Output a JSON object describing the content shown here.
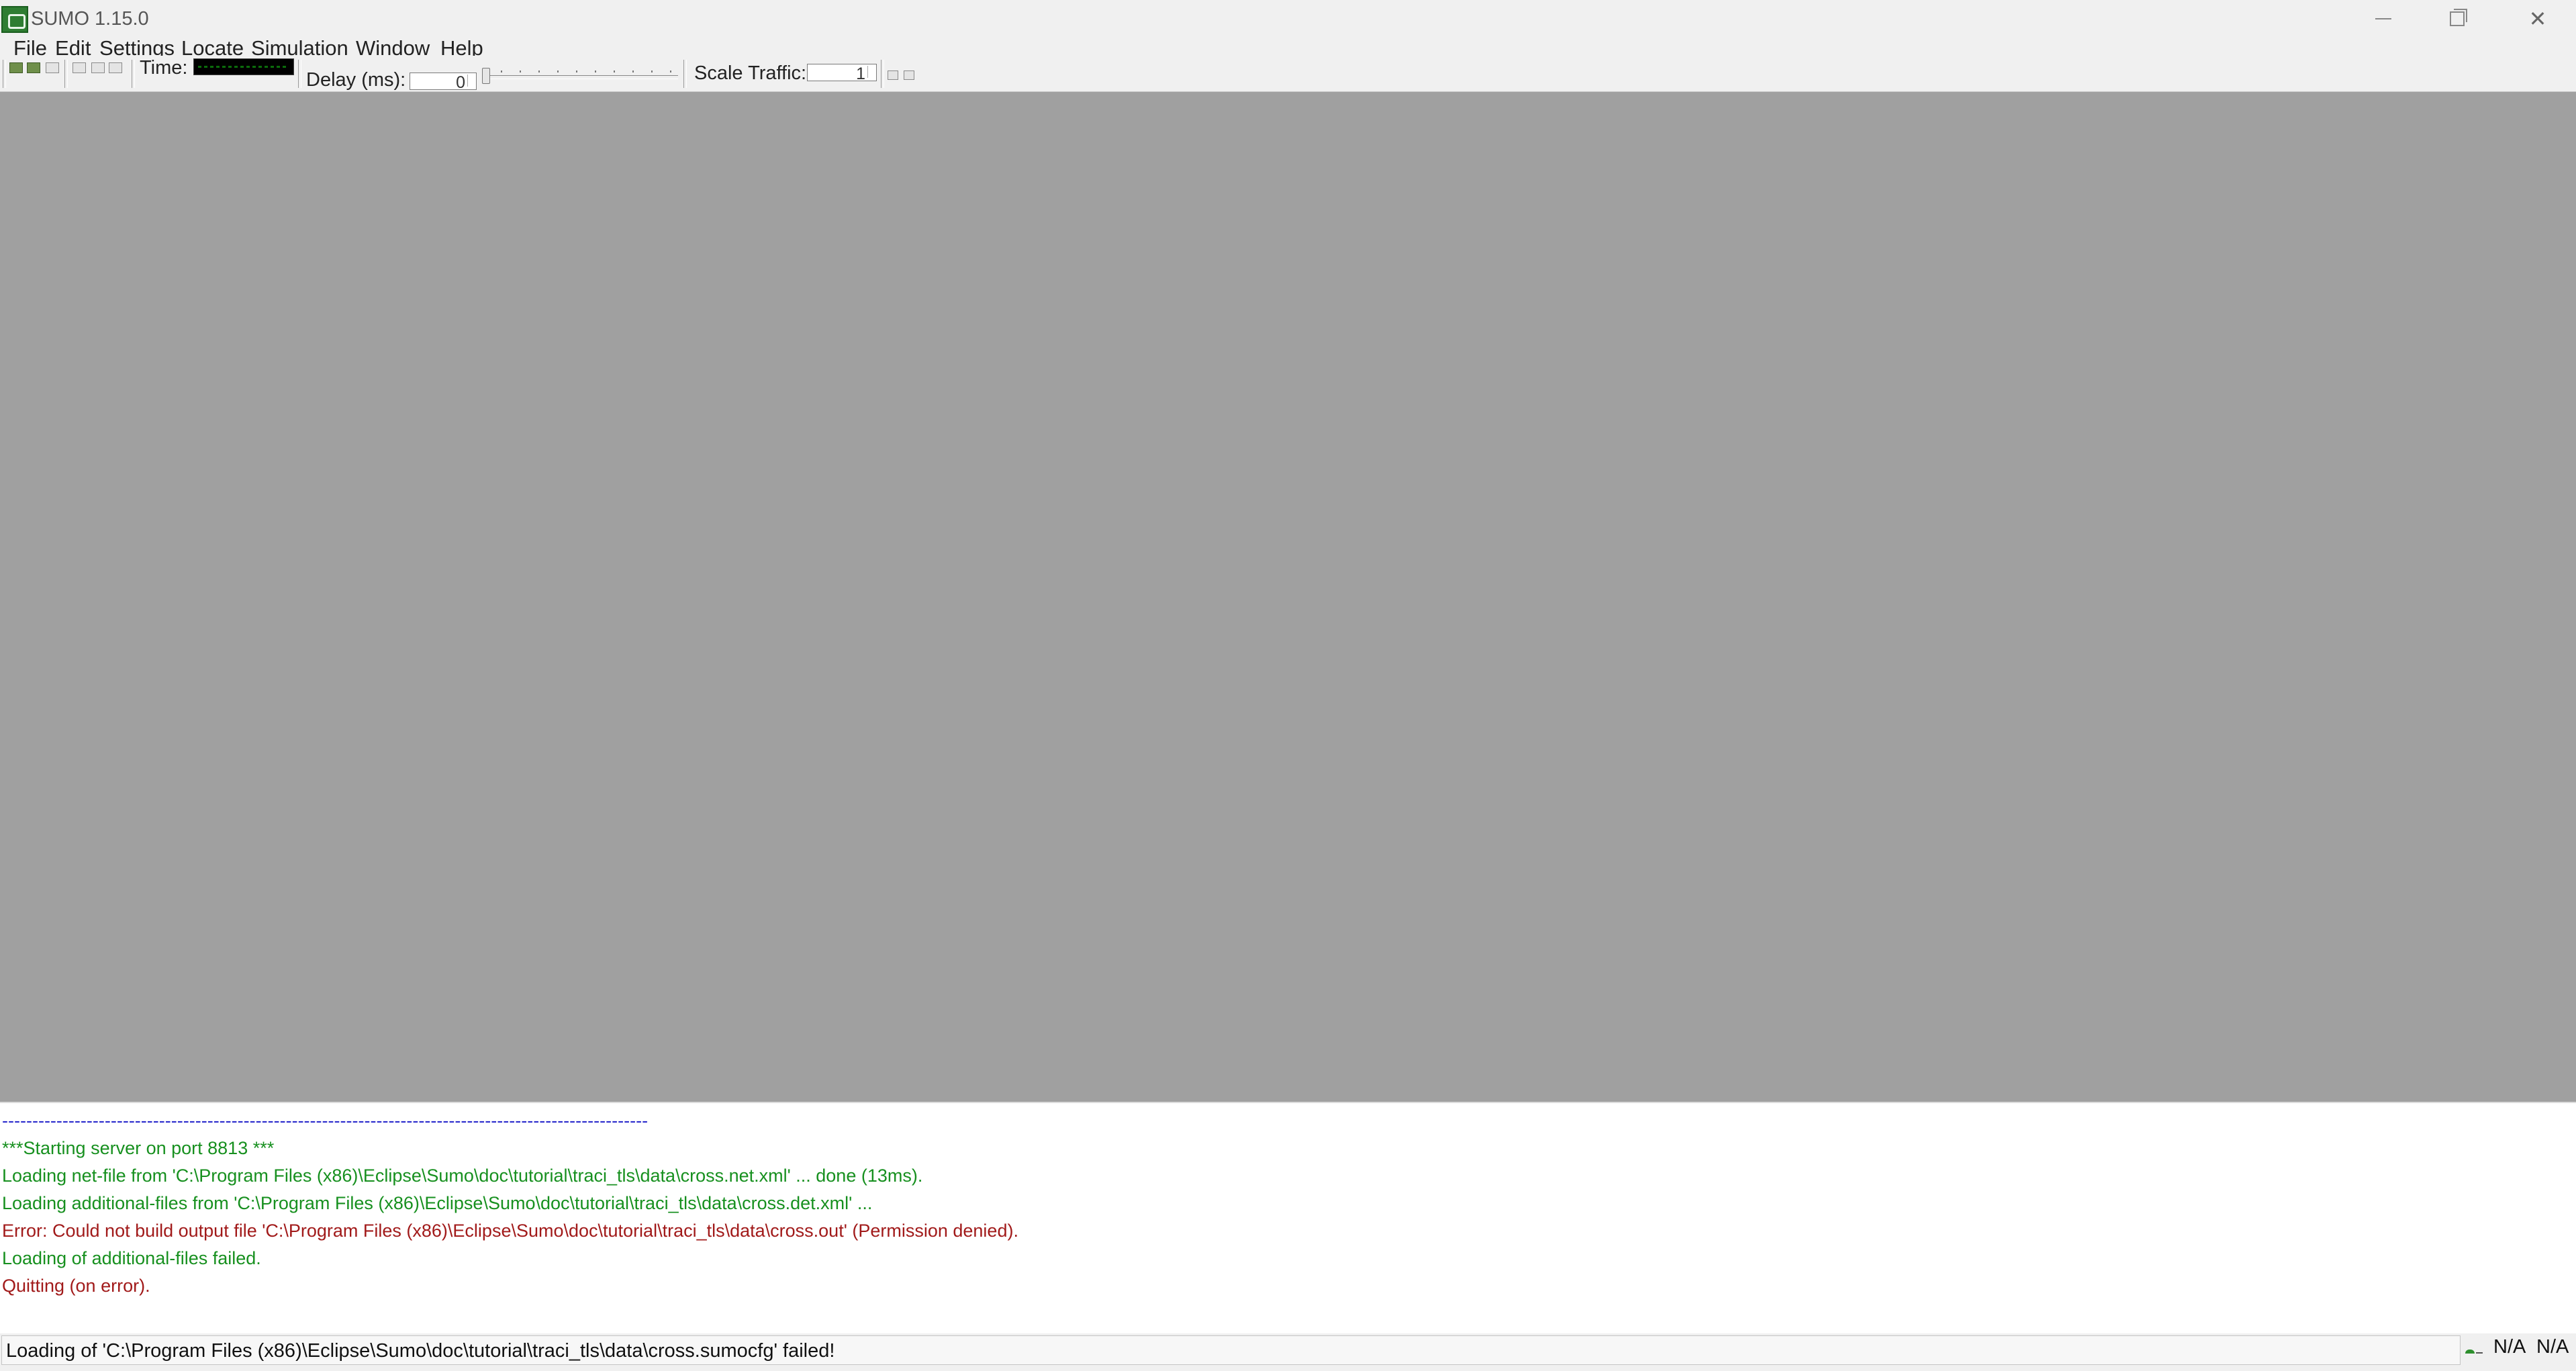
{
  "window": {
    "title": "SUMO 1.15.0"
  },
  "menu": {
    "items": [
      "File",
      "Edit",
      "Settings",
      "Locate",
      "Simulation",
      "Window",
      "Help"
    ]
  },
  "toolbar": {
    "time_label": "Time:",
    "delay_label": "Delay (ms):",
    "delay_value": "0",
    "scale_label": "Scale Traffic:",
    "scale_value": "1"
  },
  "log": {
    "lines": [
      {
        "text": "-----------------------------------------------------------------------------------------------------------",
        "status": "separator"
      },
      {
        "text": "***Starting server on port 8813 ***",
        "status": "ok"
      },
      {
        "text": "Loading net-file from 'C:\\Program Files (x86)\\Eclipse\\Sumo\\doc\\tutorial\\traci_tls\\data\\cross.net.xml' ... done (13ms).",
        "status": "ok"
      },
      {
        "text": "Loading additional-files from 'C:\\Program Files (x86)\\Eclipse\\Sumo\\doc\\tutorial\\traci_tls\\data\\cross.det.xml' ...",
        "status": "ok"
      },
      {
        "text": "Error: Could not build output file 'C:\\Program Files (x86)\\Eclipse\\Sumo\\doc\\tutorial\\traci_tls\\data\\cross.out' (Permission denied).",
        "status": "error"
      },
      {
        "text": "Loading of additional-files failed.",
        "status": "ok"
      },
      {
        "text": "Quitting (on error).",
        "status": "error"
      }
    ]
  },
  "status": {
    "message": "Loading of 'C:\\Program Files (x86)\\Eclipse\\Sumo\\doc\\tutorial\\traci_tls\\data\\cross.sumocfg' failed!",
    "coord_x": "N/A",
    "coord_y": "N/A"
  },
  "colors": {
    "canvas": "#a0a0a0",
    "log_separator": "#2a2acc",
    "log_ok": "#17901f",
    "log_error": "#a11a1a"
  }
}
